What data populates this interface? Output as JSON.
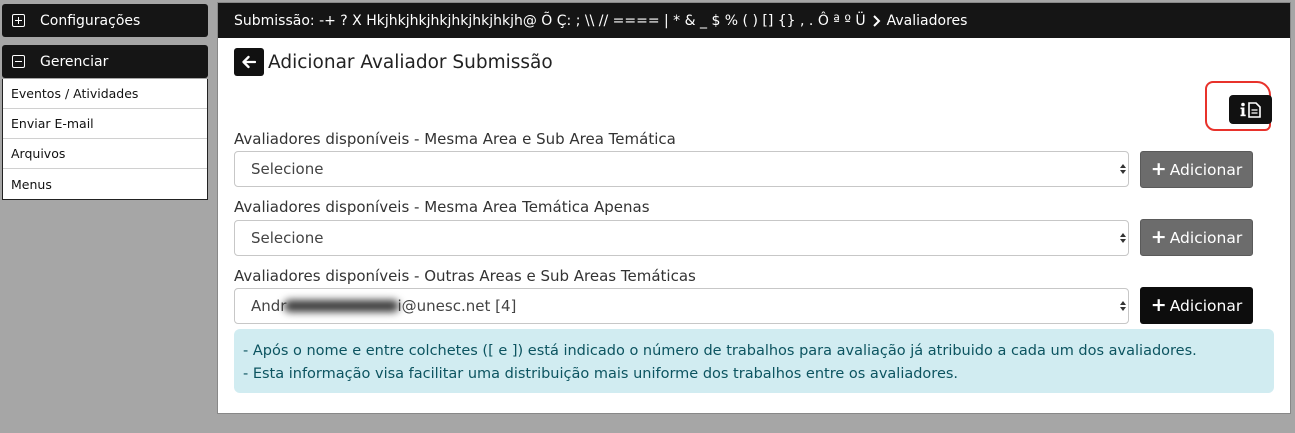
{
  "sidebar": {
    "config_label": "Configurações",
    "manage_label": "Gerenciar",
    "items": [
      {
        "label": "Eventos / Atividades"
      },
      {
        "label": "Enviar E-mail"
      },
      {
        "label": "Arquivos"
      },
      {
        "label": "Menus"
      }
    ]
  },
  "breadcrumb": {
    "submission": "Submissão: -+ ? X Hkjhkjhkjhkjhkjhkjhkjh@ Õ Ç: ; \\\\ // ==== | * & _ $ % ( ) [] {} , . Ô ª º Ü",
    "current": "Avaliadores"
  },
  "page": {
    "title": "Adicionar Avaliador Submissão"
  },
  "fields": [
    {
      "label": "Avaliadores disponíveis - Mesma Area e Sub Area Temática",
      "value": "Selecione",
      "button": "Adicionar"
    },
    {
      "label": "Avaliadores disponíveis - Mesma Area Temática Apenas",
      "value": "Selecione",
      "button": "Adicionar"
    },
    {
      "label": "Avaliadores disponíveis - Outras Areas e Sub Areas Temáticas",
      "value_prefix": "Andr",
      "value_suffix": "i@unesc.net [4]",
      "button": "Adicionar"
    }
  ],
  "note": {
    "line1": "- Após o nome e entre colchetes ([ e ]) está indicado o número de trabalhos para avaliação já atribuido a cada um dos avaliadores.",
    "line2": "- Esta informação visa facilitar uma distribuição mais uniforme dos trabalhos entre os avaliadores."
  },
  "colors": {
    "header_bg": "#151515",
    "button_gray": "#6c6c6c",
    "button_dark": "#0d0d0d",
    "info_bg": "#d1ecf1",
    "info_text": "#0c5460",
    "highlight": "#e8322b"
  },
  "icons": {
    "config": "plus-square-icon",
    "manage": "minus-square-icon",
    "back": "arrow-left-icon",
    "info": "info-file-icon",
    "breadcrumb_sep": "chevron-right-icon"
  }
}
